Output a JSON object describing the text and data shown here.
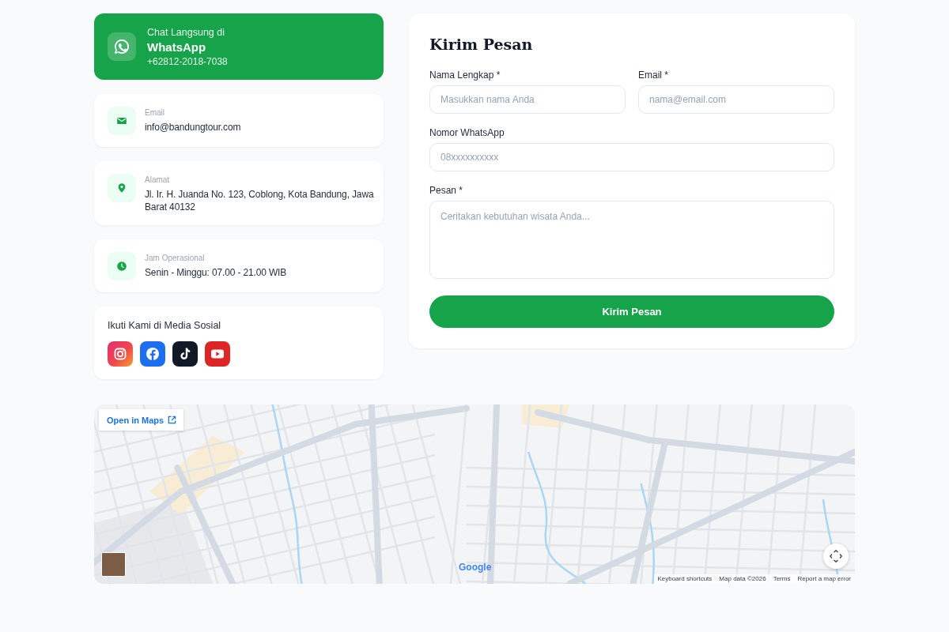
{
  "contact": {
    "whatsapp": {
      "caption": "Chat Langsung di",
      "title": "WhatsApp",
      "phone": "+62812-2018-7038"
    },
    "items": [
      {
        "kind": "email",
        "label": "Email",
        "value": "info@bandungtour.com"
      },
      {
        "kind": "address",
        "label": "Alamat",
        "value": "Jl. Ir. H. Juanda No. 123, Coblong, Kota Bandung, Jawa Barat 40132"
      },
      {
        "kind": "hours",
        "label": "Jam Operasional",
        "value": "Senin - Minggu: 07.00 - 21.00 WIB"
      }
    ],
    "social": {
      "title": "Ikuti Kami di Media Sosial",
      "links": [
        {
          "kind": "instagram"
        },
        {
          "kind": "facebook"
        },
        {
          "kind": "tiktok"
        },
        {
          "kind": "youtube"
        }
      ]
    }
  },
  "form": {
    "title": "Kirim Pesan",
    "rows": [
      [
        {
          "kind": "text",
          "label": "Nama Lengkap *",
          "placeholder": "Masukkan nama Anda"
        },
        {
          "kind": "email",
          "label": "Email *",
          "placeholder": "nama@email.com"
        }
      ],
      [
        {
          "kind": "phone",
          "label": "Nomor WhatsApp",
          "placeholder": "08xxxxxxxxxx"
        }
      ],
      [
        {
          "kind": "textarea",
          "label": "Pesan *",
          "placeholder": "Ceritakan kebutuhan wisata Anda..."
        }
      ]
    ],
    "submit": "Kirim Pesan"
  },
  "map": {
    "open_link": "Open in Maps",
    "logo": "Google",
    "attribution": [
      "Keyboard shortcuts",
      "Map data ©2026",
      "Terms",
      "Report a map error"
    ]
  }
}
